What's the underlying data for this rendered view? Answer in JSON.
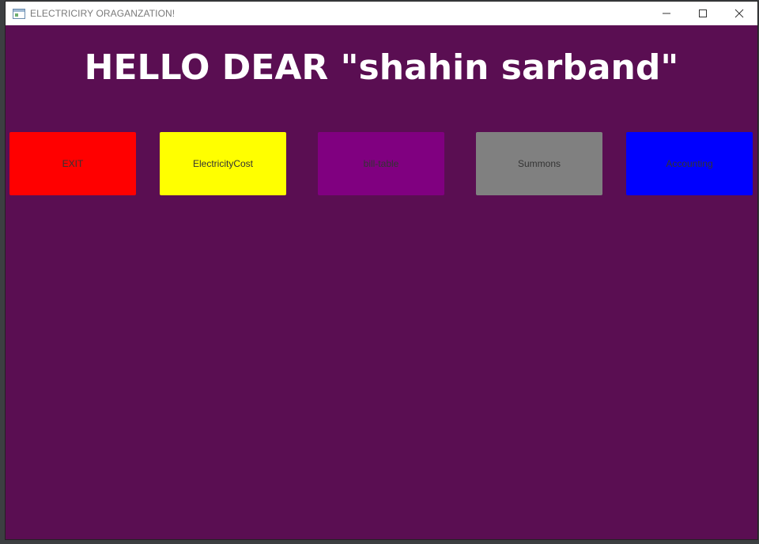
{
  "window": {
    "title": "ELECTRICIRY ORAGANZATION!",
    "icon": "app-window-icon",
    "controls": {
      "minimize_icon": "minimize-icon",
      "maximize_icon": "maximize-icon",
      "close_icon": "close-icon"
    }
  },
  "main": {
    "heading": "HELLO DEAR \"shahin sarband\"",
    "background_color": "#5a0e52",
    "buttons": [
      {
        "label": "EXIT",
        "color": "#ff0000"
      },
      {
        "label": "ElectricityCost",
        "color": "#ffff00"
      },
      {
        "label": "bill-table",
        "color": "#800080"
      },
      {
        "label": "Summons",
        "color": "#808080"
      },
      {
        "label": "Accounting",
        "color": "#0000ff"
      }
    ]
  }
}
